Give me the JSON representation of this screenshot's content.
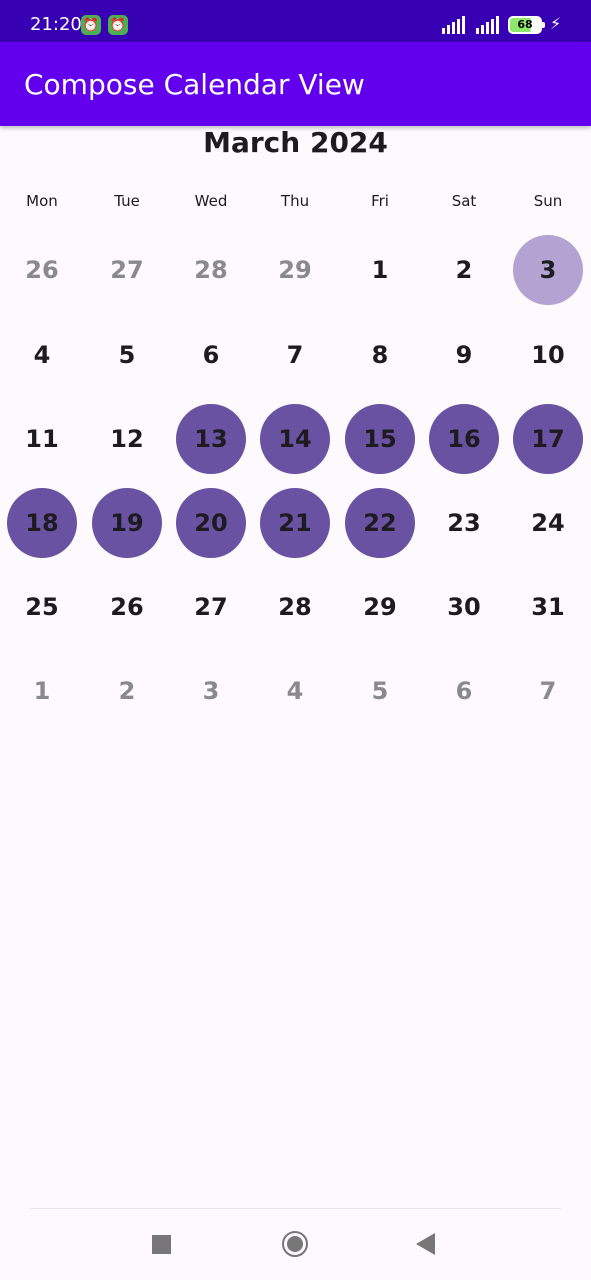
{
  "status_bar": {
    "time": "21:20",
    "notification_icons": [
      "alarm-icon",
      "alarm-icon"
    ],
    "battery_level": "68",
    "charging": true
  },
  "app_bar": {
    "title": "Compose Calendar View"
  },
  "calendar": {
    "month_title": "March 2024",
    "weekdays": [
      "Mon",
      "Tue",
      "Wed",
      "Thu",
      "Fri",
      "Sat",
      "Sun"
    ],
    "weeks": [
      [
        {
          "label": "26",
          "state": "out"
        },
        {
          "label": "27",
          "state": "out"
        },
        {
          "label": "28",
          "state": "out"
        },
        {
          "label": "29",
          "state": "out"
        },
        {
          "label": "1",
          "state": "normal"
        },
        {
          "label": "2",
          "state": "normal"
        },
        {
          "label": "3",
          "state": "today"
        }
      ],
      [
        {
          "label": "4",
          "state": "normal"
        },
        {
          "label": "5",
          "state": "normal"
        },
        {
          "label": "6",
          "state": "normal"
        },
        {
          "label": "7",
          "state": "normal"
        },
        {
          "label": "8",
          "state": "normal"
        },
        {
          "label": "9",
          "state": "normal"
        },
        {
          "label": "10",
          "state": "normal"
        }
      ],
      [
        {
          "label": "11",
          "state": "normal"
        },
        {
          "label": "12",
          "state": "normal"
        },
        {
          "label": "13",
          "state": "selected"
        },
        {
          "label": "14",
          "state": "selected"
        },
        {
          "label": "15",
          "state": "selected"
        },
        {
          "label": "16",
          "state": "selected"
        },
        {
          "label": "17",
          "state": "selected"
        }
      ],
      [
        {
          "label": "18",
          "state": "selected"
        },
        {
          "label": "19",
          "state": "selected"
        },
        {
          "label": "20",
          "state": "selected"
        },
        {
          "label": "21",
          "state": "selected"
        },
        {
          "label": "22",
          "state": "selected"
        },
        {
          "label": "23",
          "state": "normal"
        },
        {
          "label": "24",
          "state": "normal"
        }
      ],
      [
        {
          "label": "25",
          "state": "normal"
        },
        {
          "label": "26",
          "state": "normal"
        },
        {
          "label": "27",
          "state": "normal"
        },
        {
          "label": "28",
          "state": "normal"
        },
        {
          "label": "29",
          "state": "normal"
        },
        {
          "label": "30",
          "state": "normal"
        },
        {
          "label": "31",
          "state": "normal"
        }
      ],
      [
        {
          "label": "1",
          "state": "out"
        },
        {
          "label": "2",
          "state": "out"
        },
        {
          "label": "3",
          "state": "out"
        },
        {
          "label": "4",
          "state": "out"
        },
        {
          "label": "5",
          "state": "out"
        },
        {
          "label": "6",
          "state": "out"
        },
        {
          "label": "7",
          "state": "out"
        }
      ]
    ]
  },
  "colors": {
    "status_bar": "#3700b3",
    "app_bar": "#6200ee",
    "selected_day": "#6a52a2",
    "today": "#b3a3d3",
    "background": "#fdf9fd"
  },
  "nav_bar": {
    "icons": [
      "recents-square-icon",
      "home-circle-icon",
      "back-triangle-icon"
    ]
  }
}
